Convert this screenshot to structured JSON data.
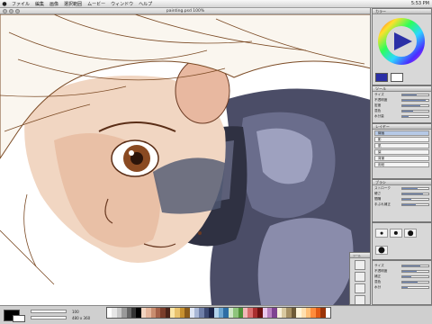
{
  "menubar": {
    "apple": "",
    "items": [
      "ファイル",
      "編集",
      "画像",
      "選択範囲",
      "ムービー",
      "ウィンドウ",
      "ヘルプ"
    ],
    "clock": "5:53 PM"
  },
  "document": {
    "title": "painting.psd 100%"
  },
  "statusbar": {
    "zoom_value": "100",
    "size_label": "480 x 360"
  },
  "palette_colors": [
    "#ffffff",
    "#e6e6e6",
    "#c8c8c8",
    "#9a9a9a",
    "#666",
    "#333",
    "#000",
    "#f2d4c0",
    "#e5b69c",
    "#c98d6f",
    "#a46148",
    "#7a3e2a",
    "#4a2418",
    "#fbe6a8",
    "#e9c26d",
    "#c7912f",
    "#8a5b1a",
    "#dfe6f4",
    "#a9b7d6",
    "#6f7fa8",
    "#3d4a73",
    "#1b2447",
    "#b2d3ec",
    "#6da6d0",
    "#2d6ea5",
    "#cfe7c7",
    "#8ec47c",
    "#4f9139",
    "#f1b7b7",
    "#d96f6f",
    "#a92f2f",
    "#6b1010",
    "#e9c7ec",
    "#b882c1",
    "#7f4391",
    "#f7f0da",
    "#d9c9a0",
    "#a69063",
    "#6e5b37",
    "#fff5d9",
    "#ffe0b0",
    "#ffc078",
    "#ff8c3c",
    "#e25a14",
    "#9c3509",
    "#ffffff"
  ],
  "color_wheel": {
    "title": "カラー",
    "current_hex": "#2b2fa6"
  },
  "tool_panel": {
    "title": "ツール",
    "rows": [
      {
        "label": "サイズ",
        "value": 0.55
      },
      {
        "label": "不透明度",
        "value": 0.9
      },
      {
        "label": "密度",
        "value": 0.7
      },
      {
        "label": "混色",
        "value": 0.4
      },
      {
        "label": "水分量",
        "value": 0.25
      }
    ]
  },
  "layers": {
    "title": "レイヤー",
    "items": [
      "線画",
      "影",
      "肌",
      "髪",
      "背景",
      "用紙"
    ]
  },
  "brush_panel": {
    "title": "ブラシ",
    "rows": [
      {
        "label": "ストローク",
        "value": 0.6
      },
      {
        "label": "硬さ",
        "value": 0.8
      },
      {
        "label": "間隔",
        "value": 0.35
      },
      {
        "label": "手ぶれ補正",
        "value": 0.5
      }
    ]
  },
  "brush_sizes": [
    4,
    6,
    8,
    10,
    12,
    3,
    5,
    7,
    9,
    11
  ],
  "brush_options": {
    "rows": [
      {
        "label": "サイズ",
        "value": 0.45
      },
      {
        "label": "不透明度",
        "value": 0.75
      },
      {
        "label": "ブラシ濃度",
        "value": 0.6
      },
      {
        "label": "ぼかし",
        "value": 0.3
      }
    ]
  },
  "toolbox": {
    "title": "ツール"
  },
  "bottom_panel": {
    "rows": [
      {
        "label": "サイズ",
        "value": 0.7
      },
      {
        "label": "不透明度",
        "value": 0.55
      },
      {
        "label": "補正",
        "value": 0.35
      },
      {
        "label": "混色",
        "value": 0.6
      },
      {
        "label": "水分",
        "value": 0.2
      }
    ]
  }
}
